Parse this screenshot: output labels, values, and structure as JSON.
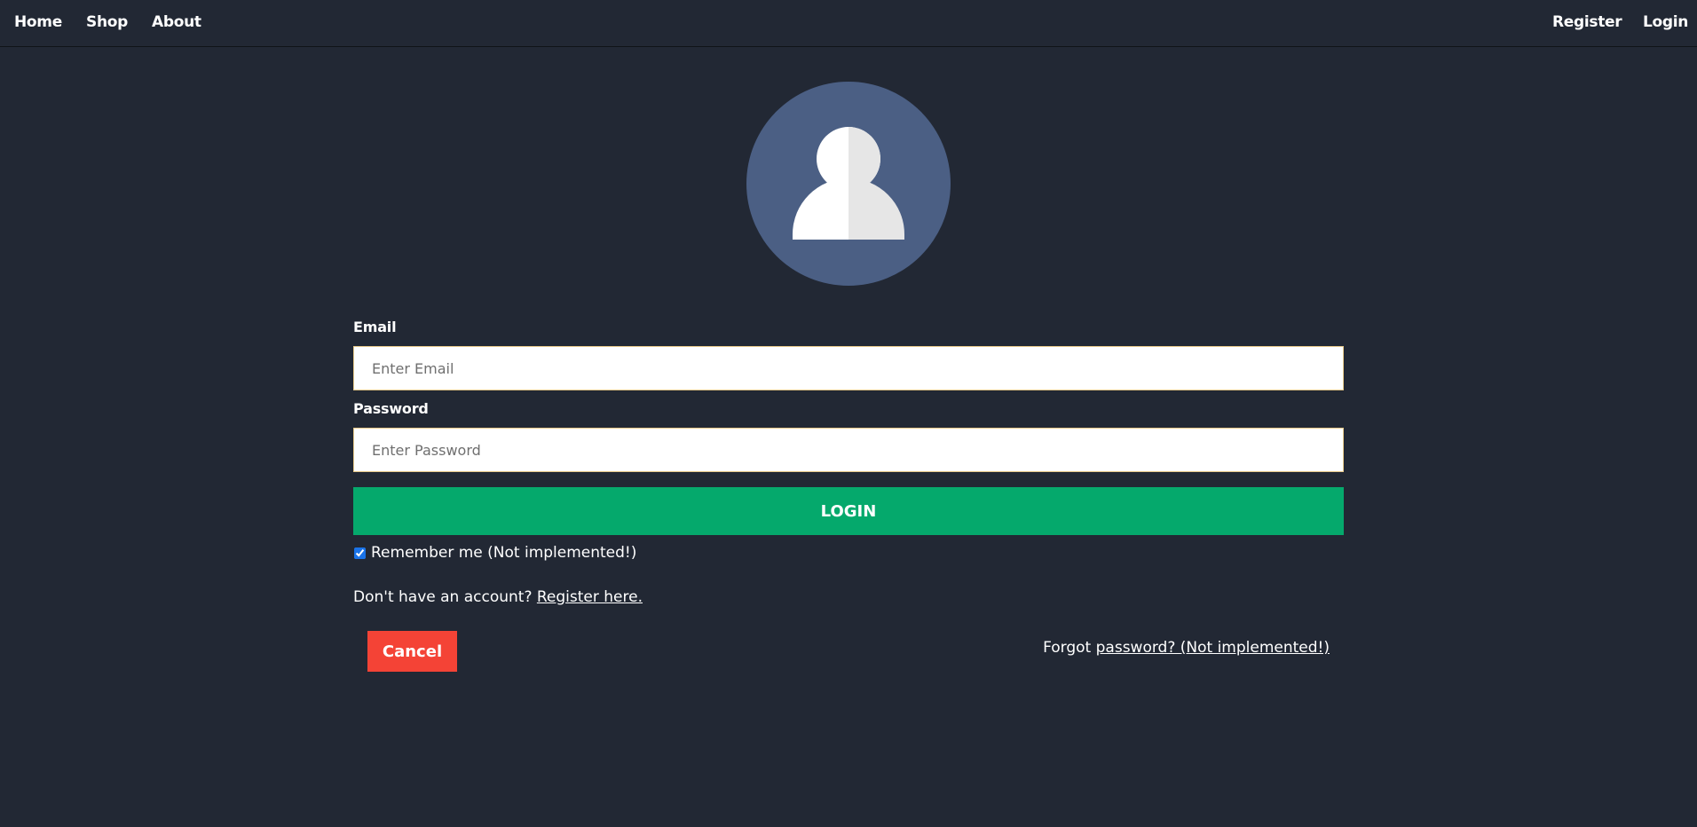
{
  "nav": {
    "left": [
      "Home",
      "Shop",
      "About"
    ],
    "right": [
      "Register",
      "Login"
    ]
  },
  "avatar": {
    "icon": "user-icon",
    "bg_color": "#4b5f84"
  },
  "form": {
    "email_label": "Email",
    "email_placeholder": "Enter Email",
    "email_value": "",
    "password_label": "Password",
    "password_placeholder": "Enter Password",
    "password_value": "",
    "login_label": "LOGIN",
    "remember_label": "Remember me (Not implemented!)",
    "remember_checked": true,
    "register_prompt": "Don't have an account?",
    "register_link": "Register here.",
    "cancel_label": "Cancel",
    "forgot_prefix": "Forgot",
    "forgot_link": "password? (Not implemented!)"
  },
  "colors": {
    "background": "#222834",
    "login_button": "#05a96c",
    "cancel_button": "#f44336",
    "input_border": "#e7c98a"
  }
}
